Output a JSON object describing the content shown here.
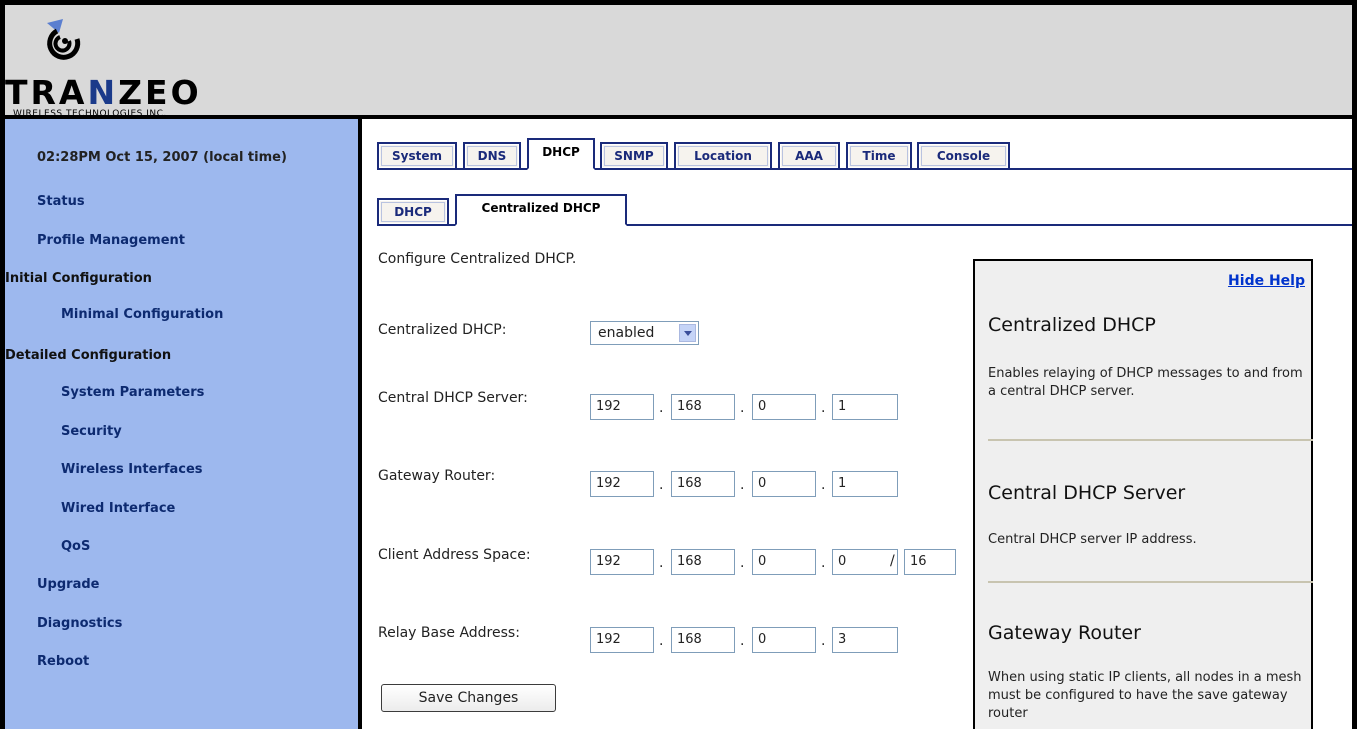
{
  "brand": {
    "logo_pre": "TRA",
    "logo_n": "N",
    "logo_post": "ZEO",
    "tagline": "WIRELESS TECHNOLOGIES INC."
  },
  "sidebar": {
    "clock": "02:28PM Oct 15, 2007 (local time)",
    "items": [
      {
        "label": "Status"
      },
      {
        "label": "Profile Management"
      },
      {
        "label": "Initial Configuration"
      },
      {
        "label": "Minimal Configuration"
      },
      {
        "label": "Detailed Configuration"
      },
      {
        "label": "System Parameters"
      },
      {
        "label": "Security"
      },
      {
        "label": "Wireless Interfaces"
      },
      {
        "label": "Wired Interface"
      },
      {
        "label": "QoS"
      },
      {
        "label": "Upgrade"
      },
      {
        "label": "Diagnostics"
      },
      {
        "label": "Reboot"
      }
    ]
  },
  "tabs": {
    "main": [
      "System",
      "DNS",
      "DHCP",
      "SNMP",
      "Location",
      "AAA",
      "Time",
      "Console"
    ],
    "active_main": "DHCP",
    "sub": [
      "DHCP",
      "Centralized DHCP"
    ],
    "active_sub": "Centralized DHCP"
  },
  "form": {
    "intro": "Configure Centralized DHCP.",
    "centralized_label": "Centralized DHCP:",
    "centralized_value": "enabled",
    "server_label": "Central DHCP Server:",
    "server": [
      "192",
      "168",
      "0",
      "1"
    ],
    "gateway_label": "Gateway Router:",
    "gateway": [
      "192",
      "168",
      "0",
      "1"
    ],
    "client_label": "Client Address Space:",
    "client": [
      "192",
      "168",
      "0",
      "0"
    ],
    "client_prefix": "16",
    "relay_label": "Relay Base Address:",
    "relay": [
      "192",
      "168",
      "0",
      "3"
    ],
    "dot": ".",
    "slash": "/",
    "save_label": "Save Changes"
  },
  "help": {
    "hide_label": "Hide Help",
    "sections": [
      {
        "title": "Centralized DHCP",
        "text": "Enables relaying of DHCP messages to and from a central DHCP server."
      },
      {
        "title": "Central DHCP Server",
        "text": "Central DHCP server IP address."
      },
      {
        "title": "Gateway Router",
        "text": "When using static IP clients, all nodes in a mesh must be configured to have the save gateway router"
      }
    ]
  },
  "colors": {
    "sidebar_bg": "#9db8ee",
    "header_bg": "#d9d9d9",
    "tab_border": "#1a2a7a",
    "link": "#0033cc"
  }
}
